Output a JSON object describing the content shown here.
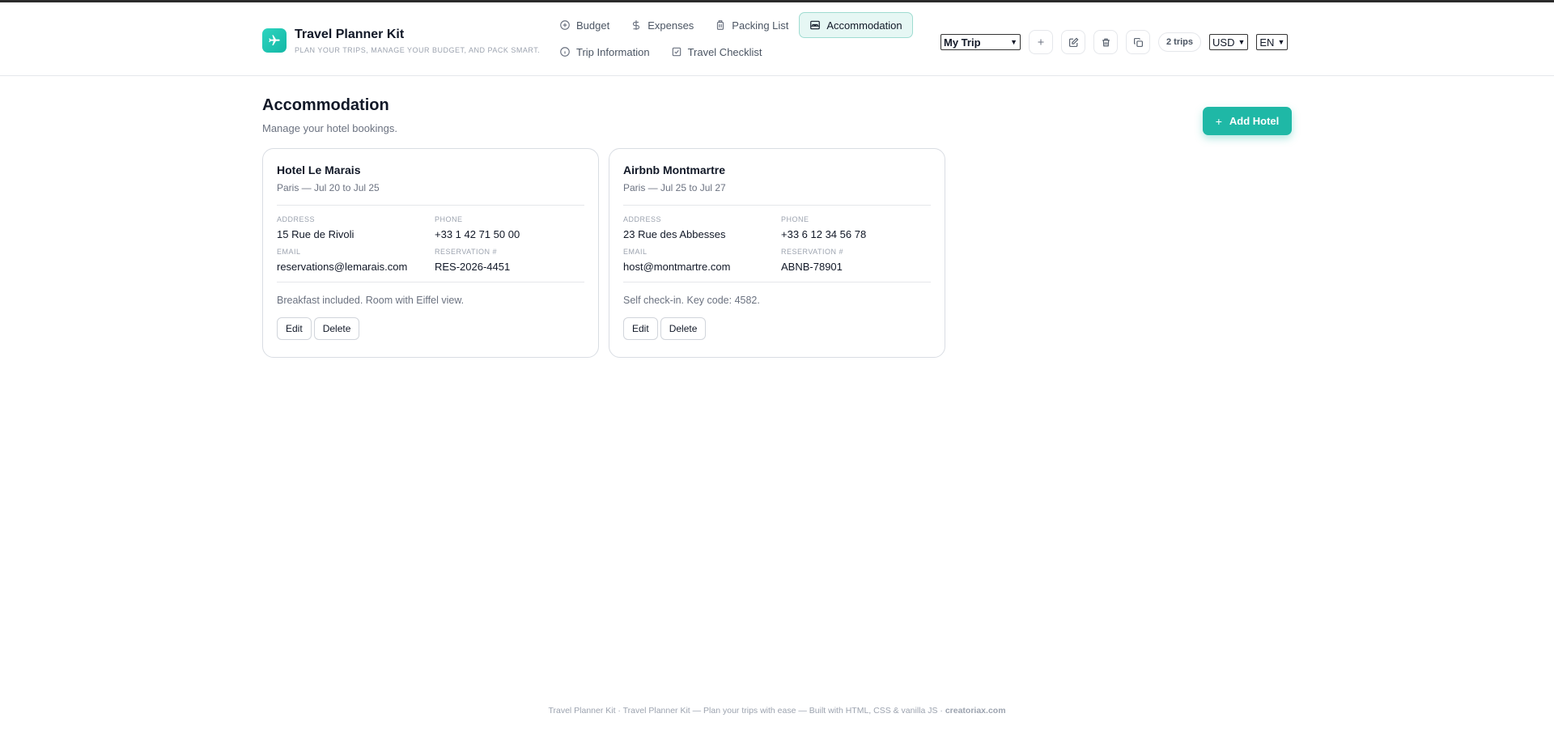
{
  "brand": {
    "title": "Travel Planner Kit",
    "subtitle": "Plan your trips, manage your budget, and pack smart."
  },
  "nav": {
    "row1": [
      {
        "label": "Budget",
        "icon": "plus-circle-icon"
      },
      {
        "label": "Expenses",
        "icon": "dollar-icon"
      },
      {
        "label": "Packing List",
        "icon": "luggage-icon"
      },
      {
        "label": "Accommodation",
        "icon": "bed-icon",
        "active": true
      }
    ],
    "row2": [
      {
        "label": "Trip Information",
        "icon": "info-icon"
      },
      {
        "label": "Travel Checklist",
        "icon": "checkbox-icon"
      }
    ]
  },
  "controls": {
    "trip_selected": "My Trip",
    "trips_count": "2 trips",
    "currency": "USD",
    "language": "EN"
  },
  "page": {
    "title": "Accommodation",
    "subtitle": "Manage your hotel bookings.",
    "add_button": "Add Hotel"
  },
  "labels": {
    "address": "Address",
    "phone": "Phone",
    "email": "Email",
    "reservation": "Reservation #",
    "edit": "Edit",
    "delete": "Delete"
  },
  "hotels": [
    {
      "name": "Hotel Le Marais",
      "subtitle": "Paris — Jul 20 to Jul 25",
      "address": "15 Rue de Rivoli",
      "phone": "+33 1 42 71 50 00",
      "email": "reservations@lemarais.com",
      "reservation": "RES-2026-4451",
      "notes": "Breakfast included. Room with Eiffel view."
    },
    {
      "name": "Airbnb Montmartre",
      "subtitle": "Paris — Jul 25 to Jul 27",
      "address": "23 Rue des Abbesses",
      "phone": "+33 6 12 34 56 78",
      "email": "host@montmartre.com",
      "reservation": "ABNB-78901",
      "notes": "Self check-in. Key code: 4582."
    }
  ],
  "footer": {
    "text": "Travel Planner Kit · Travel Planner Kit — Plan your trips with ease — Built with HTML, CSS & vanilla JS · ",
    "link": "creatoriax.com"
  },
  "colors": {
    "accent": "#1fb8a6",
    "active_tab_bg": "#e6f7f4"
  }
}
